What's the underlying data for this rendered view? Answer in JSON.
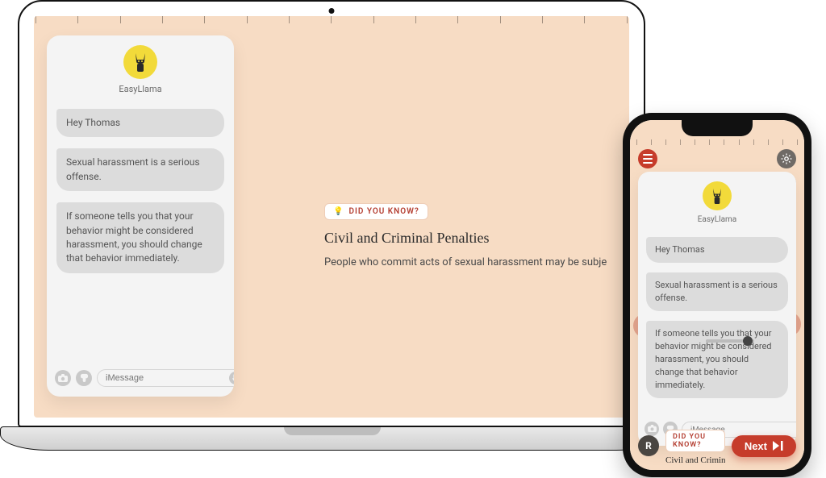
{
  "chat": {
    "name": "EasyLlama",
    "placeholder": "iMessage",
    "messages": [
      "Hey Thomas",
      "Sexual harassment is a serious offense.",
      "If someone tells you that your behavior might be considered harassment, you should change that behavior immediately."
    ]
  },
  "content": {
    "badge_icon": "💡",
    "badge_text": "DID YOU KNOW?",
    "heading": "Civil and Criminal Penalties",
    "paragraph_desktop": "People who commit acts of sexual harassment may be subje",
    "heading_phone": "Civil and Criminal Penalties"
  },
  "phone": {
    "next_label": "Next",
    "help_label": "?",
    "recycle_label": "R"
  }
}
